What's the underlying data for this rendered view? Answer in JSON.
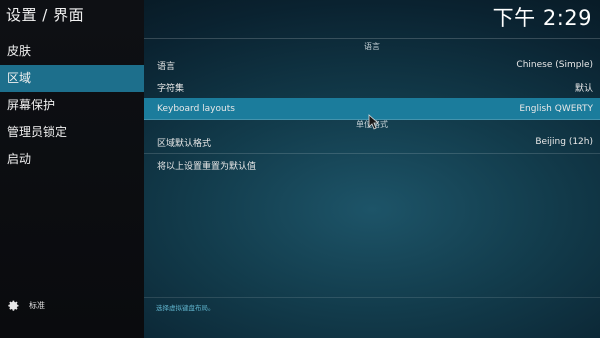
{
  "header": {
    "title": "设置 / 界面"
  },
  "clock": "下午 2:29",
  "sidebar": {
    "items": [
      {
        "label": "皮肤",
        "active": false
      },
      {
        "label": "区域",
        "active": true
      },
      {
        "label": "屏幕保护",
        "active": false
      },
      {
        "label": "管理员锁定",
        "active": false
      },
      {
        "label": "启动",
        "active": false
      }
    ],
    "footer": {
      "icon": "gear-icon",
      "label": "标准"
    }
  },
  "main": {
    "section_language": "语言",
    "rows": [
      {
        "label": "语言",
        "value": "Chinese (Simple)"
      },
      {
        "label": "字符集",
        "value": "默认"
      },
      {
        "label": "Keyboard layouts",
        "value": "English QWERTY"
      }
    ],
    "section_units": "单位格式",
    "region_row": {
      "label": "区域默认格式",
      "value": "Beijing (12h)"
    },
    "reset_row": {
      "label": "将以上设置重置为默认值"
    },
    "hint": "选择虚拟键盘布局。"
  },
  "colors": {
    "accent": "#1d6f8c",
    "row_highlight": "#1b7c9c",
    "hint": "#5fb3cc"
  }
}
